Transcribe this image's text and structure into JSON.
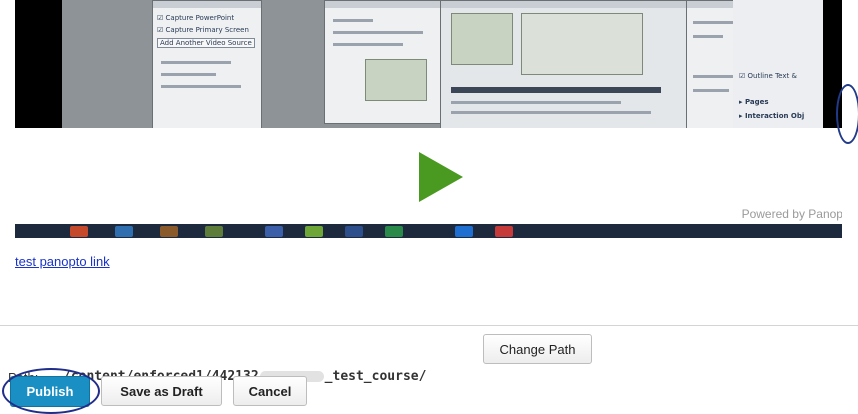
{
  "editor": {
    "video": {
      "powered_by": "Powered by Panopto",
      "embedded_menu": {
        "item1": "Capture PowerPoint",
        "item2": "Capture Primary Screen",
        "item3": "Add Another Video Source",
        "right_item1": "Outline Text &",
        "right_item2": "Pages",
        "right_item3": "Interaction Obj"
      }
    },
    "link_text": "test panopto link"
  },
  "path": {
    "label": "Path:",
    "value_prefix": "/content/enforced1/442132",
    "value_suffix": "_test_course/",
    "change_button": "Change Path"
  },
  "actions": {
    "publish": "Publish",
    "save_draft": "Save as Draft",
    "cancel": "Cancel"
  },
  "colors": {
    "publish_bg": "#1a8fc4",
    "play_icon": "#4a9a21",
    "link": "#1a33c9",
    "annotation_ring": "#1f2e8a"
  }
}
